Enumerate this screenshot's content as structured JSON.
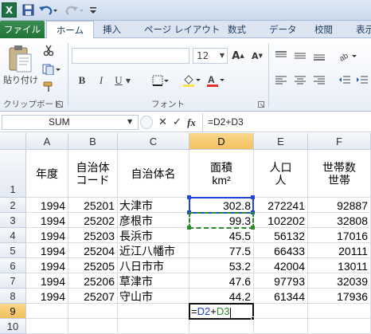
{
  "app": {
    "logo_letter": "X",
    "accent_color": "#21733a",
    "highlight_color": "#f1c15f"
  },
  "qat": {
    "save_icon": "save-icon",
    "undo_icon": "undo-icon",
    "redo_icon": "redo-icon",
    "customize_icon": "customize-icon"
  },
  "tabs": [
    "ファイル",
    "ホーム",
    "挿入",
    "ページ レイアウト",
    "数式",
    "データ",
    "校閲",
    "表示"
  ],
  "ribbon": {
    "clipboard": {
      "paste_label": "貼り付け",
      "group_label": "クリップボード"
    },
    "font": {
      "font_name": "",
      "font_size": "12",
      "bold": "B",
      "italic": "I",
      "underline": "U",
      "group_label": "フォント"
    }
  },
  "formula_bar": {
    "name_box": "SUM",
    "cancel": "✕",
    "enter": "✓",
    "fx": "fx",
    "formula": "=D2+D3"
  },
  "grid": {
    "columns": [
      "A",
      "B",
      "C",
      "D",
      "E",
      "F"
    ],
    "rows": [
      "1",
      "2",
      "3",
      "4",
      "5",
      "6",
      "7",
      "8",
      "9",
      "10"
    ],
    "header": {
      "a": "年度",
      "b_line1": "自治体",
      "b_line2": "コード",
      "c": "自治体名",
      "d_line1": "面積",
      "d_line2": "km²",
      "e_line1": "人口",
      "e_line2": "人",
      "f_line1": "世帯数",
      "f_line2": "世帯"
    },
    "data": [
      [
        "1994",
        "25201",
        "大津市",
        "302.8",
        "272241",
        "92887"
      ],
      [
        "1994",
        "25202",
        "彦根市",
        "99.3",
        "102202",
        "32808"
      ],
      [
        "1994",
        "25203",
        "長浜市",
        "45.5",
        "56132",
        "17016"
      ],
      [
        "1994",
        "25204",
        "近江八幡市",
        "77.5",
        "66433",
        "20111"
      ],
      [
        "1994",
        "25205",
        "八日市市",
        "53.2",
        "42004",
        "13011"
      ],
      [
        "1994",
        "25206",
        "草津市",
        "47.6",
        "97793",
        "32039"
      ],
      [
        "1994",
        "25207",
        "守山市",
        "44.2",
        "61344",
        "17936"
      ]
    ],
    "edit_cell": {
      "eq": "=",
      "ref1": "D2",
      "plus": "+",
      "ref2": "D3"
    }
  }
}
